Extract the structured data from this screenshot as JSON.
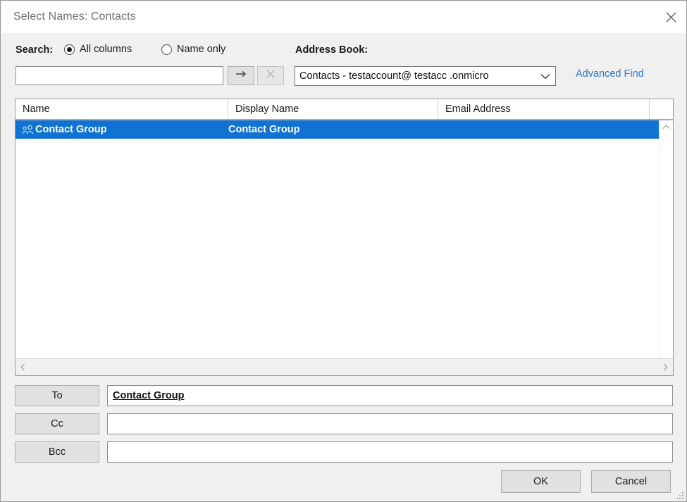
{
  "window": {
    "title": "Select Names: Contacts",
    "close_icon": "close-icon"
  },
  "search": {
    "label": "Search:",
    "options": [
      {
        "label": "All columns",
        "selected": true
      },
      {
        "label": "Name only",
        "selected": false
      }
    ],
    "input_value": "",
    "input_placeholder": "",
    "go_icon": "arrow-right-icon",
    "clear_icon": "clear-x-icon"
  },
  "address_book": {
    "label": "Address Book:",
    "selected": "Contacts - testaccount@  testacc .onmicro",
    "dropdown_icon": "chevron-down-icon",
    "advanced_find": "Advanced Find"
  },
  "list": {
    "columns": [
      "Name",
      "Display Name",
      "Email Address",
      ""
    ],
    "rows": [
      {
        "icon": "contact-group-icon",
        "name": "Contact Group",
        "display_name": "Contact Group",
        "email": "",
        "selected": true
      }
    ],
    "scroll": {
      "up_icon": "chevron-up-icon",
      "down_icon": "chevron-down-icon",
      "left_icon": "chevron-left-icon",
      "right_icon": "chevron-right-icon"
    }
  },
  "recipients": [
    {
      "button": "To",
      "value": "Contact Group",
      "chip": true
    },
    {
      "button": "Cc",
      "value": "",
      "chip": false
    },
    {
      "button": "Bcc",
      "value": "",
      "chip": false
    }
  ],
  "footer": {
    "ok": "OK",
    "cancel": "Cancel",
    "grip_icon": "resize-grip-icon"
  },
  "colors": {
    "selection_blue": "#1073d3",
    "link_blue": "#2b77d4",
    "dialog_bg": "#f0f0f0",
    "border_gray": "#9a9a9a"
  }
}
